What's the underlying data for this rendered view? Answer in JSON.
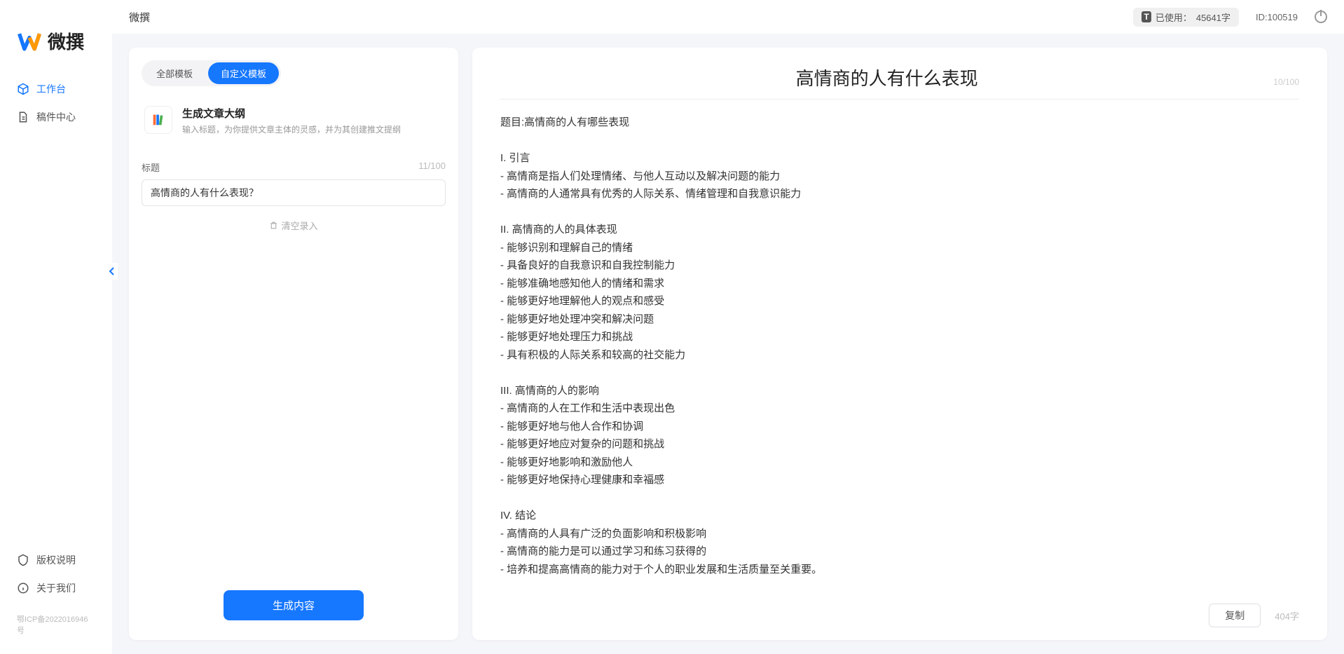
{
  "app": {
    "name": "微撰"
  },
  "sidebar": {
    "nav": [
      {
        "label": "工作台",
        "active": true
      },
      {
        "label": "稿件中心",
        "active": false
      }
    ],
    "footer": [
      {
        "label": "版权说明"
      },
      {
        "label": "关于我们"
      }
    ],
    "icp": "鄂ICP备2022016946号"
  },
  "topbar": {
    "title": "微撰",
    "usage_prefix": "已使用：",
    "usage_value": "45641字",
    "user_id": "ID:100519"
  },
  "left_panel": {
    "tabs": [
      {
        "label": "全部模板",
        "active": false
      },
      {
        "label": "自定义模板",
        "active": true
      }
    ],
    "template": {
      "title": "生成文章大纲",
      "desc": "输入标题，为你提供文章主体的灵感，并为其创建推文提纲"
    },
    "field": {
      "label": "标题",
      "count": "11/100",
      "value": "高情商的人有什么表现？"
    },
    "clear_label": "清空录入",
    "generate_label": "生成内容"
  },
  "right_panel": {
    "title": "高情商的人有什么表现",
    "title_count": "10/100",
    "body": "题目:高情商的人有哪些表现\n\nI. 引言\n- 高情商是指人们处理情绪、与他人互动以及解决问题的能力\n- 高情商的人通常具有优秀的人际关系、情绪管理和自我意识能力\n\nII. 高情商的人的具体表现\n- 能够识别和理解自己的情绪\n- 具备良好的自我意识和自我控制能力\n- 能够准确地感知他人的情绪和需求\n- 能够更好地理解他人的观点和感受\n- 能够更好地处理冲突和解决问题\n- 能够更好地处理压力和挑战\n- 具有积极的人际关系和较高的社交能力\n\nIII. 高情商的人的影响\n- 高情商的人在工作和生活中表现出色\n- 能够更好地与他人合作和协调\n- 能够更好地应对复杂的问题和挑战\n- 能够更好地影响和激励他人\n- 能够更好地保持心理健康和幸福感\n\nIV. 结论\n- 高情商的人具有广泛的负面影响和积极影响\n- 高情商的能力是可以通过学习和练习获得的\n- 培养和提高高情商的能力对于个人的职业发展和生活质量至关重要。",
    "copy_label": "复制",
    "word_count": "404字"
  }
}
